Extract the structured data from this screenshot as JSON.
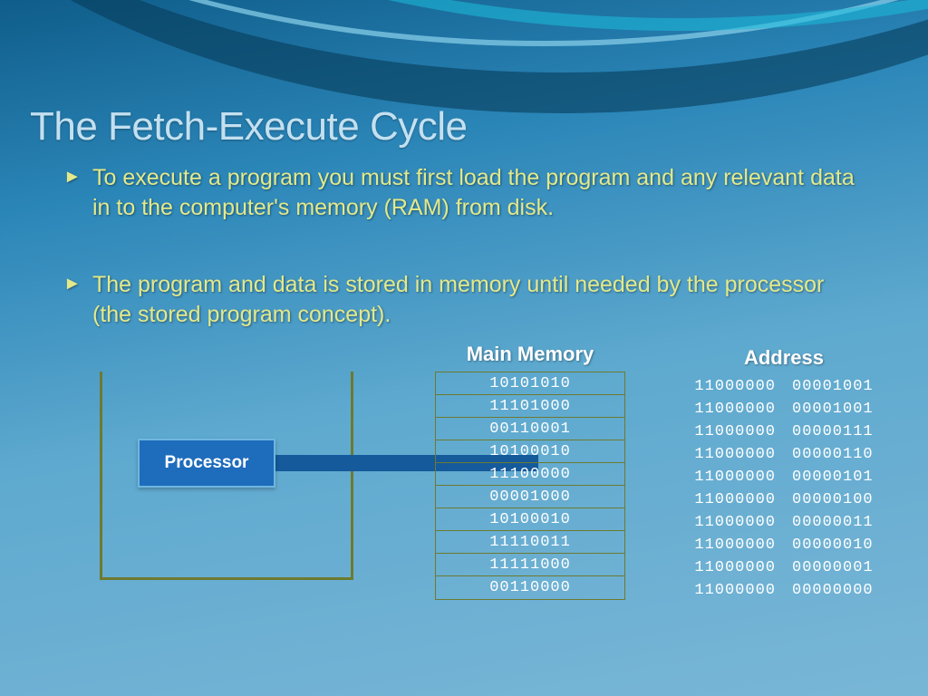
{
  "title": "The Fetch-Execute Cycle",
  "bullets": [
    "To execute a program you must first load the program and any relevant data  in to the computer's memory (RAM) from disk.",
    "The program and data is stored in memory until needed by the processor  (the stored program concept)."
  ],
  "processor_label": "Processor",
  "memory_label": "Main Memory",
  "memory_cells": [
    "10101010",
    "11101000",
    "00110001",
    "10100010",
    "11100000",
    "00001000",
    "10100010",
    "11110011",
    "11111000",
    "00110000"
  ],
  "address_label": "Address",
  "addresses": [
    [
      "11000000",
      "00001001"
    ],
    [
      "11000000",
      "00001001"
    ],
    [
      "11000000",
      "00000111"
    ],
    [
      "11000000",
      "00000110"
    ],
    [
      "11000000",
      "00000101"
    ],
    [
      "11000000",
      "00000100"
    ],
    [
      "11000000",
      "00000011"
    ],
    [
      "11000000",
      "00000010"
    ],
    [
      "11000000",
      "00000001"
    ],
    [
      "11000000",
      "00000000"
    ]
  ]
}
